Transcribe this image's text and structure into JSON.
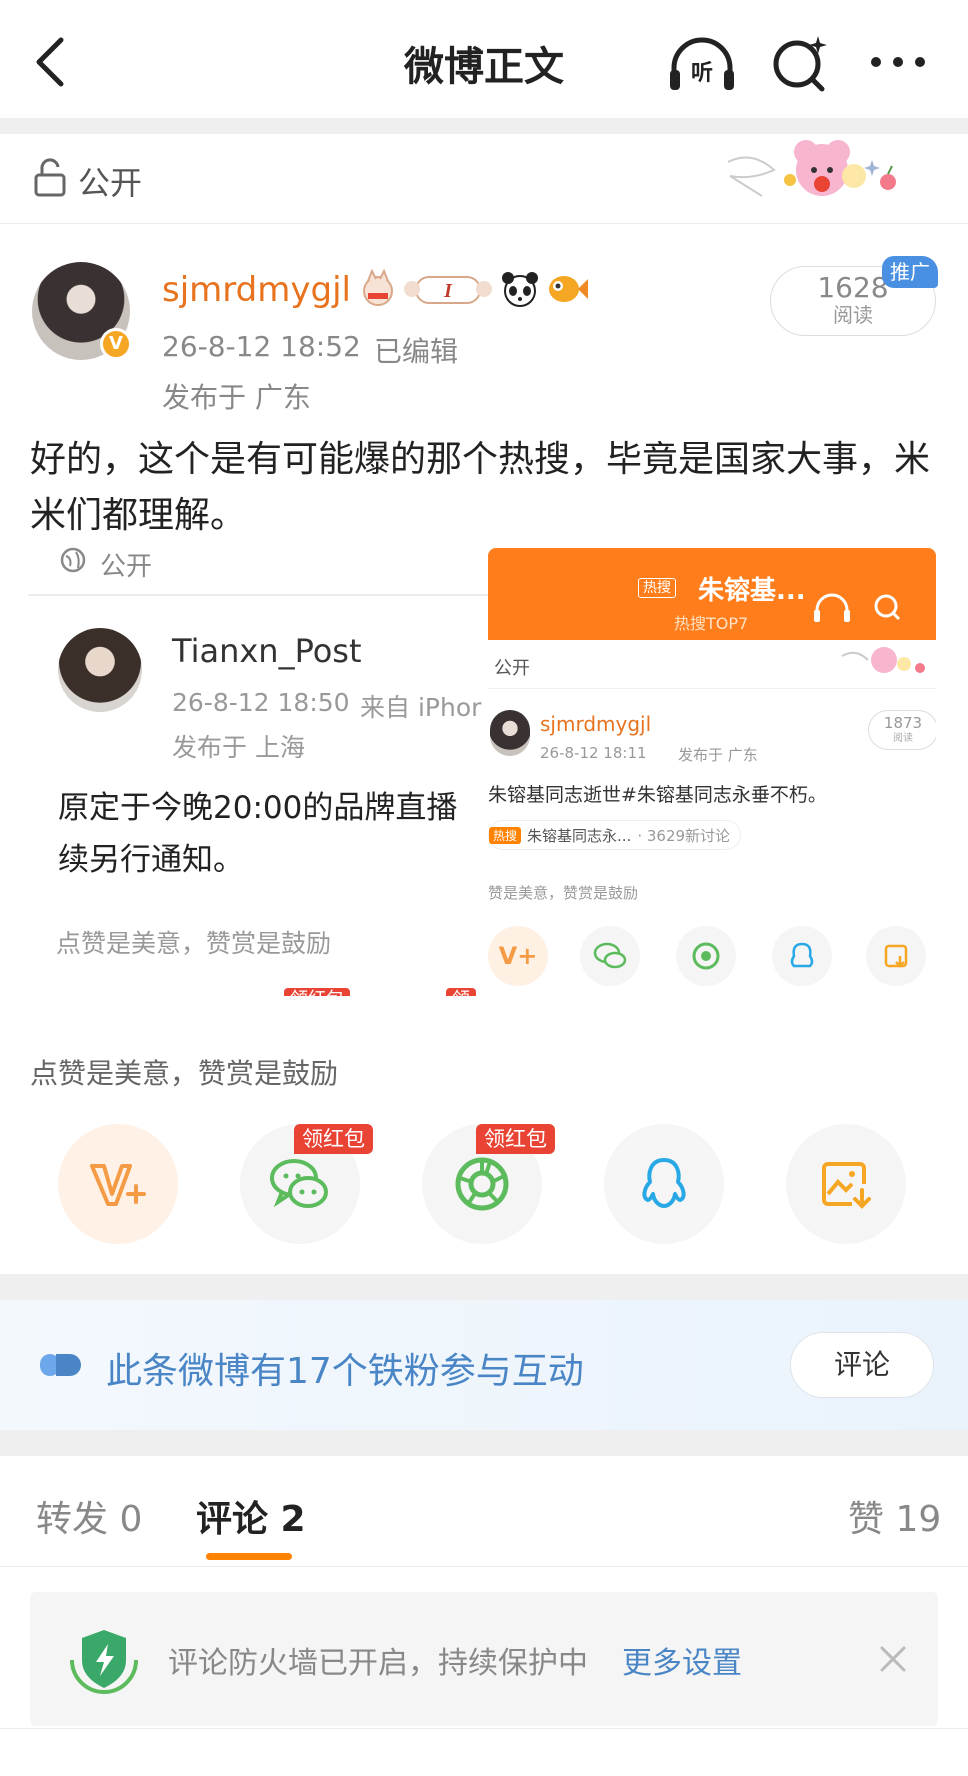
{
  "header": {
    "title": "微博正文",
    "listen_icon": "headphones-icon",
    "search_icon": "search-sparkle-icon",
    "more_icon": "more-dots-icon"
  },
  "visibility": {
    "label": "公开"
  },
  "post": {
    "username": "sjmrdmygjl",
    "time": "26-8-12 18:52",
    "edited": "已编辑",
    "location": "发布于 广东",
    "reads": {
      "count": "1628",
      "label": "阅读",
      "promo": "推广"
    },
    "text": "好的，这个是有可能爆的那个热搜，毕竟是国家大事，米米们都理解。"
  },
  "embedded_left": {
    "visibility": "公开",
    "username": "Tianxn_Post",
    "time": "26-8-12 18:50",
    "source": "来自 iPhor",
    "location": "发布于 上海",
    "text": "原定于今晚20:00的品牌直播",
    "text2": "续另行通知。",
    "appreciate": "点赞是美意，赞赏是鼓励",
    "hongbao1": "领红包",
    "hongbao2": "领"
  },
  "embedded_right": {
    "banner_badge": "热搜",
    "banner_title": "朱镕基...",
    "banner_sub": "热搜TOP7",
    "visibility": "公开",
    "username": "sjmrdmygjl",
    "time": "26-8-12 18:11",
    "location": "发布于 广东",
    "reads": "1873",
    "reads_label": "阅读",
    "text": "朱镕基同志逝世#朱镕基同志永垂不朽。",
    "topic_badge": "热搜",
    "topic": "朱镕基同志永...",
    "topic_count": "· 3629新讨论",
    "appreciate": "赞是美意，赞赏是鼓励"
  },
  "appreciate": {
    "text": "点赞是美意，赞赏是鼓励"
  },
  "share": {
    "hongbao_wechat": "领红包",
    "hongbao_moments": "领红包"
  },
  "fans": {
    "text": "此条微博有17个铁粉参与互动",
    "comment_btn": "评论"
  },
  "tabs": {
    "repost": "转发 0",
    "comments": "评论 2",
    "likes": "赞 19"
  },
  "firewall": {
    "text": "评论防火墙已开启，持续保护中",
    "link": "更多设置"
  },
  "colors": {
    "orange": "#ff8200",
    "link_blue": "#4a86c6",
    "red": "#e94334",
    "wechat_green": "#5cbb5c"
  }
}
